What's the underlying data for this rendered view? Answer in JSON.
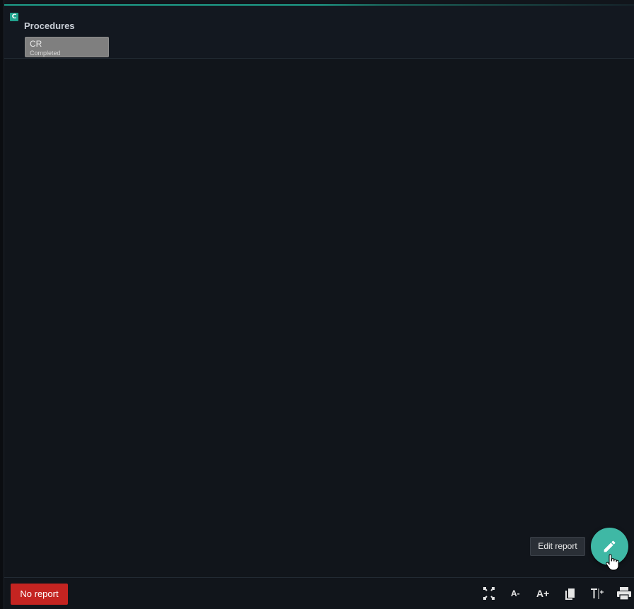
{
  "header": {
    "badge": "C",
    "title": "Procedures",
    "procedure": {
      "name": "CR",
      "status": "Completed"
    }
  },
  "tooltip": {
    "text": "Edit report"
  },
  "fab": {
    "icon": "pencil-icon",
    "color": "#3fb8a5"
  },
  "footer": {
    "status_button": "No report",
    "status_color": "#c42421",
    "tools": [
      {
        "name": "fullscreen-icon"
      },
      {
        "label": "A-",
        "name": "decrease-font-icon"
      },
      {
        "label": "A+",
        "name": "increase-font-icon"
      },
      {
        "name": "copy-icon"
      },
      {
        "name": "text-size-icon"
      },
      {
        "name": "print-icon"
      }
    ]
  },
  "colors": {
    "accent": "#21a38e",
    "background": "#11151b"
  }
}
